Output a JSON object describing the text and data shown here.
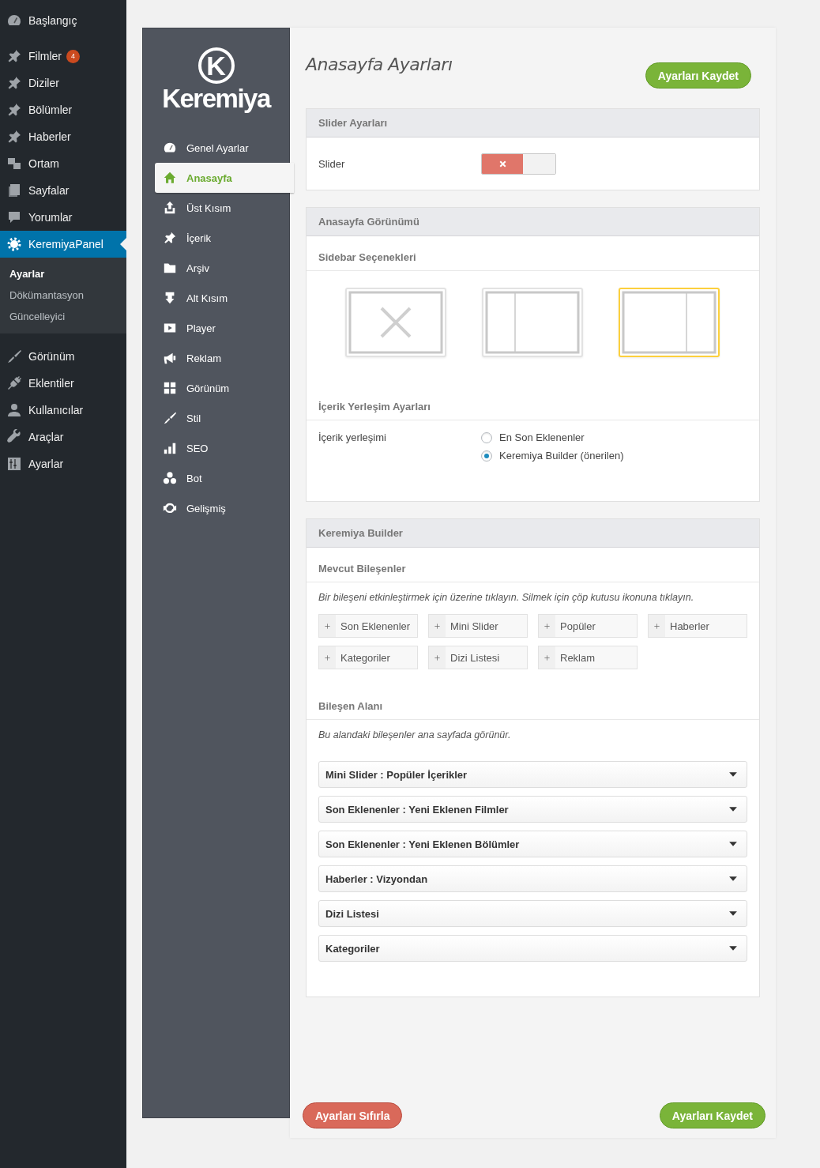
{
  "admin_menu": {
    "items": [
      {
        "label": "Başlangıç",
        "selected": false
      },
      {
        "label": "Filmler",
        "selected": false,
        "badge": "4"
      },
      {
        "label": "Diziler",
        "selected": false
      },
      {
        "label": "Bölümler",
        "selected": false
      },
      {
        "label": "Haberler",
        "selected": false
      },
      {
        "label": "Ortam",
        "selected": false
      },
      {
        "label": "Sayfalar",
        "selected": false
      },
      {
        "label": "Yorumlar",
        "selected": false
      },
      {
        "label": "KeremiyaPanel",
        "selected": true,
        "children": [
          {
            "label": "Ayarlar",
            "selected": true
          },
          {
            "label": "Dökümantasyon",
            "selected": false
          },
          {
            "label": "Güncelleyici",
            "selected": false
          }
        ]
      },
      {
        "label": "Görünüm",
        "selected": false
      },
      {
        "label": "Eklentiler",
        "selected": false
      },
      {
        "label": "Kullanıcılar",
        "selected": false
      },
      {
        "label": "Araçlar",
        "selected": false
      },
      {
        "label": "Ayarlar",
        "selected": false
      }
    ]
  },
  "panel_nav": {
    "logo": {
      "mark": "K",
      "name": "Keremiya"
    },
    "items": [
      {
        "label": "Genel Ayarlar",
        "selected": false
      },
      {
        "label": "Anasayfa",
        "selected": true
      },
      {
        "label": "Üst Kısım",
        "selected": false
      },
      {
        "label": "İçerik",
        "selected": false
      },
      {
        "label": "Arşiv",
        "selected": false
      },
      {
        "label": "Alt Kısım",
        "selected": false
      },
      {
        "label": "Player",
        "selected": false
      },
      {
        "label": "Reklam",
        "selected": false
      },
      {
        "label": "Görünüm",
        "selected": false
      },
      {
        "label": "Stil",
        "selected": false
      },
      {
        "label": "SEO",
        "selected": false
      },
      {
        "label": "Bot",
        "selected": false
      },
      {
        "label": "Gelişmiş",
        "selected": false
      }
    ]
  },
  "page": {
    "title": "Anasayfa Ayarları",
    "save_button": "Ayarları Kaydet"
  },
  "slider_section": {
    "title": "Slider Ayarları",
    "label": "Slider",
    "on": false
  },
  "homepage_view": {
    "title": "Anasayfa Görünümü",
    "sidebar_heading": "Sidebar Seçenekleri",
    "sidebar_options": [
      {
        "kind": "none",
        "selected": false
      },
      {
        "kind": "left",
        "selected": false
      },
      {
        "kind": "right",
        "selected": true
      }
    ],
    "layout_heading": "İçerik Yerleşim Ayarları",
    "layout_label": "İçerik yerleşimi",
    "layout_options": [
      {
        "label": "En Son Eklenenler",
        "selected": false
      },
      {
        "label": "Keremiya Builder (önerilen)",
        "selected": true
      }
    ]
  },
  "builder": {
    "title": "Keremiya Builder",
    "available_heading": "Mevcut Bileşenler",
    "available_hint": "Bir bileşeni etkinleştirmek için üzerine tıklayın. Silmek için çöp kutusu ikonuna tıklayın.",
    "components": [
      "Son Eklenenler",
      "Mini Slider",
      "Popüler",
      "Haberler",
      "Kategoriler",
      "Dizi Listesi",
      "Reklam"
    ],
    "area_heading": "Bileşen Alanı",
    "area_hint": "Bu alandaki bileşenler ana sayfada görünür.",
    "area_items": [
      "Mini Slider : Popüler İçerikler",
      "Son Eklenenler : Yeni Eklenen Filmler",
      "Son Eklenenler : Yeni Eklenen Bölümler",
      "Haberler : Vizyondan",
      "Dizi Listesi",
      "Kategoriler"
    ]
  },
  "footer": {
    "reset_button": "Ayarları Sıfırla",
    "save_button": "Ayarları Kaydet"
  }
}
